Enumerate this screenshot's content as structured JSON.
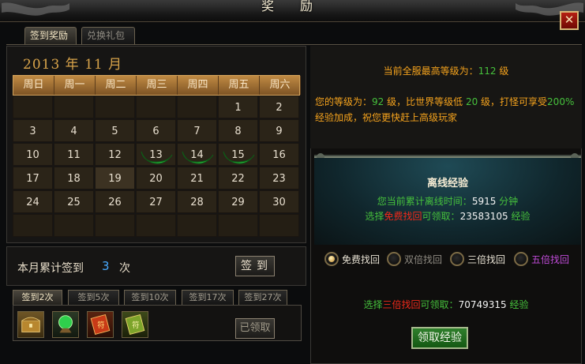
{
  "window": {
    "title": "奖 励"
  },
  "tabs": [
    {
      "label": "签到奖励",
      "active": true
    },
    {
      "label": "兑换礼包",
      "active": false
    }
  ],
  "calendar": {
    "month_title": "2013 年 11 月",
    "weekdays": [
      "周日",
      "周一",
      "周二",
      "周三",
      "周四",
      "周五",
      "周六"
    ],
    "rows": [
      [
        "",
        "",
        "",
        "",
        "",
        "1",
        "2"
      ],
      [
        "3",
        "4",
        "5",
        "6",
        "7",
        "8",
        "9"
      ],
      [
        "10",
        "11",
        "12",
        "13",
        "14",
        "15",
        "16"
      ],
      [
        "17",
        "18",
        "19",
        "20",
        "21",
        "22",
        "23"
      ],
      [
        "24",
        "25",
        "26",
        "27",
        "28",
        "29",
        "30"
      ],
      [
        "",
        "",
        "",
        "",
        "",
        "",
        ""
      ]
    ],
    "signed_days": [
      "13",
      "14",
      "15"
    ],
    "today": "19"
  },
  "summary": {
    "label": "本月累计签到",
    "count": "3",
    "unit": "次",
    "sign_button": "签到"
  },
  "reward_tabs": [
    {
      "label": "签到2次",
      "active": true
    },
    {
      "label": "签到5次",
      "active": false
    },
    {
      "label": "签到10次",
      "active": false
    },
    {
      "label": "签到17次",
      "active": false
    },
    {
      "label": "签到27次",
      "active": false
    }
  ],
  "reward_items": [
    "treasure-chest-icon",
    "green-orb-icon",
    "red-scroll-icon",
    "green-scroll-icon"
  ],
  "claimed_button": "已领取",
  "level_info": {
    "max_prefix": "当前全服最高等级为：",
    "max_value": "112",
    "max_suffix": " 级",
    "line_prefix": "您的等级为：",
    "your_level": "92",
    "line_mid": " 级，比世界等级低 ",
    "diff": "20",
    "line_suffix": " 级，打怪可享受",
    "bonus": "200%",
    "line_end": "经验加成，祝您更快赶上高级玩家"
  },
  "offline": {
    "title": "离线经验",
    "time_prefix": "您当前累计离线时间：",
    "time_value": "5915",
    "time_unit": " 分钟",
    "free_prefix": "选择",
    "free_highlight": "免费找回",
    "free_mid": "可领取：",
    "free_value": "23583105",
    "free_unit": " 经验"
  },
  "options": [
    {
      "label": "免费找回",
      "selected": true,
      "color": "#e8e2d4"
    },
    {
      "label": "双倍找回",
      "selected": false,
      "color": "#8f8b82"
    },
    {
      "label": "三倍找回",
      "selected": false,
      "color": "#e8e2d4"
    },
    {
      "label": "五倍找回",
      "selected": false,
      "color": "#c04bd8"
    }
  ],
  "triple": {
    "prefix": "选择",
    "highlight": "三倍找回",
    "mid": "可领取：",
    "value": "70749315",
    "unit": " 经验"
  },
  "claim_exp_button": "领取经验",
  "colors": {
    "accent_orange": "#f5a31d",
    "accent_green": "#46c13c",
    "accent_red": "#f0291a",
    "month_gold": "#d8a34a"
  }
}
